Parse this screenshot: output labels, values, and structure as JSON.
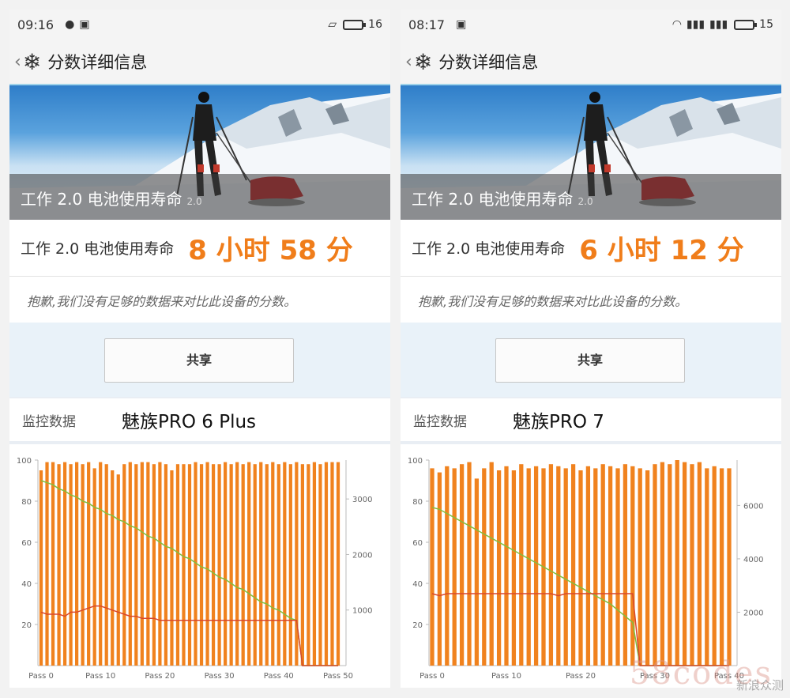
{
  "phones": [
    {
      "status": {
        "time": "09:16",
        "battery": "16"
      },
      "app": {
        "title": "分数详细信息"
      },
      "banner": {
        "label": "工作 2.0 电池使用寿命",
        "version": "2.0"
      },
      "score": {
        "label": "工作 2.0 电池使用寿命",
        "value": "8 小时 58 分"
      },
      "notice": "抱歉,我们没有足够的数据来对比此设备的分数。",
      "share_label": "共享",
      "monitor": {
        "label": "监控数据",
        "device": "魅族PRO 6 Plus"
      },
      "chart_data": {
        "type": "bar",
        "left_axis": {
          "ticks": [
            20,
            40,
            60,
            80,
            100
          ],
          "range": [
            0,
            100
          ]
        },
        "right_axis": {
          "ticks": [
            1000,
            2000,
            3000
          ],
          "range": [
            0,
            3700
          ]
        },
        "x_ticks": [
          "Pass 0",
          "Pass 10",
          "Pass 20",
          "Pass 30",
          "Pass 40",
          "Pass 50"
        ],
        "passes": 51,
        "series": [
          {
            "color": "#f0821e",
            "values": [
              95,
              99,
              99,
              98,
              99,
              98,
              99,
              98,
              99,
              96,
              99,
              98,
              95,
              93,
              98,
              99,
              98,
              99,
              99,
              98,
              99,
              98,
              95,
              98,
              98,
              98,
              99,
              98,
              99,
              98,
              98,
              99,
              98,
              99,
              98,
              99,
              98,
              99,
              98,
              99,
              98,
              99,
              98,
              99,
              98,
              98,
              99,
              98,
              99,
              99,
              99
            ]
          },
          {
            "color": "#7fbf3f",
            "values": [
              90,
              89,
              88,
              86,
              85,
              83,
              82,
              80,
              79,
              77,
              76,
              74,
              73,
              71,
              70,
              68,
              67,
              65,
              63,
              62,
              60,
              58,
              57,
              55,
              53,
              52,
              50,
              48,
              47,
              45,
              43,
              42,
              40,
              38,
              37,
              35,
              33,
              31,
              30,
              28,
              27,
              25,
              23,
              22,
              0,
              0,
              0,
              0,
              0,
              0,
              0
            ]
          },
          {
            "color": "#d9472b",
            "values": [
              26,
              25,
              25,
              25,
              24,
              26,
              26,
              27,
              28,
              29,
              29,
              28,
              27,
              26,
              25,
              24,
              24,
              23,
              23,
              23,
              22,
              22,
              22,
              22,
              22,
              22,
              22,
              22,
              22,
              22,
              22,
              22,
              22,
              22,
              22,
              22,
              22,
              22,
              22,
              22,
              22,
              22,
              22,
              22,
              0,
              0,
              0,
              0,
              0,
              0,
              0
            ]
          }
        ]
      }
    },
    {
      "status": {
        "time": "08:17",
        "battery": "15"
      },
      "app": {
        "title": "分数详细信息"
      },
      "banner": {
        "label": "工作 2.0 电池使用寿命",
        "version": "2.0"
      },
      "score": {
        "label": "工作 2.0 电池使用寿命",
        "value": "6 小时 12 分"
      },
      "notice": "抱歉,我们没有足够的数据来对比此设备的分数。",
      "share_label": "共享",
      "monitor": {
        "label": "监控数据",
        "device": "魅族PRO 7"
      },
      "chart_data": {
        "type": "bar",
        "left_axis": {
          "ticks": [
            20,
            40,
            60,
            80,
            100
          ],
          "range": [
            0,
            100
          ]
        },
        "right_axis": {
          "ticks": [
            2000,
            4000,
            6000
          ],
          "range": [
            0,
            7700
          ]
        },
        "x_ticks": [
          "Pass 0",
          "Pass 10",
          "Pass 20",
          "Pass 30",
          "Pass 40"
        ],
        "passes": 41,
        "series": [
          {
            "color": "#f0821e",
            "values": [
              96,
              94,
              97,
              96,
              98,
              99,
              91,
              96,
              99,
              95,
              97,
              95,
              98,
              96,
              97,
              96,
              98,
              97,
              96,
              98,
              95,
              97,
              96,
              98,
              97,
              96,
              98,
              97,
              96,
              95,
              98,
              99,
              98,
              100,
              99,
              98,
              99,
              96,
              97,
              96,
              96
            ]
          },
          {
            "color": "#7fbf3f",
            "values": [
              77,
              76,
              74,
              72,
              70,
              68,
              66,
              64,
              62,
              60,
              58,
              56,
              54,
              52,
              50,
              48,
              46,
              44,
              42,
              40,
              38,
              36,
              34,
              32,
              30,
              27,
              24,
              21,
              0,
              0,
              0,
              0,
              0,
              0,
              0,
              0,
              0,
              0,
              0,
              0,
              0
            ]
          },
          {
            "color": "#d9472b",
            "values": [
              35,
              34,
              35,
              35,
              35,
              35,
              35,
              35,
              35,
              35,
              35,
              35,
              35,
              35,
              35,
              35,
              35,
              34,
              35,
              35,
              35,
              35,
              35,
              35,
              35,
              35,
              35,
              35,
              0,
              0,
              0,
              0,
              0,
              0,
              0,
              0,
              0,
              0,
              0,
              0,
              0
            ]
          }
        ]
      }
    }
  ],
  "watermark": {
    "text": "58codes",
    "source": "新浪众测"
  }
}
